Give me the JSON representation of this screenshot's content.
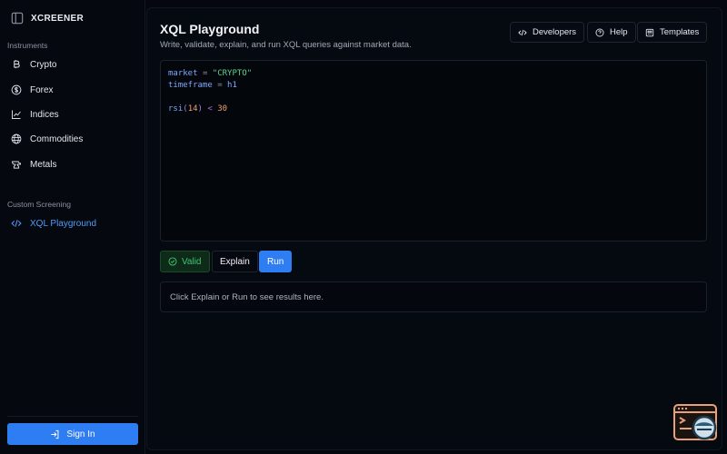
{
  "brand": {
    "name": "XCREENER"
  },
  "sidebar": {
    "section_instruments": "Instruments",
    "instruments": [
      {
        "label": "Crypto",
        "icon": "bitcoin-icon"
      },
      {
        "label": "Forex",
        "icon": "dollar-icon"
      },
      {
        "label": "Indices",
        "icon": "chart-line-icon"
      },
      {
        "label": "Commodities",
        "icon": "globe-icon"
      },
      {
        "label": "Metals",
        "icon": "anvil-icon"
      }
    ],
    "section_custom": "Custom Screening",
    "custom": [
      {
        "label": "XQL Playground",
        "icon": "code-icon",
        "active": true
      }
    ],
    "signin_label": "Sign In"
  },
  "header": {
    "title": "XQL Playground",
    "subtitle": "Write, validate, explain, and run XQL queries against market data.",
    "buttons": {
      "developers": "Developers",
      "help": "Help",
      "templates": "Templates"
    }
  },
  "editor": {
    "line1": {
      "ident": "market",
      "op": "=",
      "value": "\"CRYPTO\""
    },
    "line2": {
      "ident": "timeframe",
      "op": "=",
      "value": "h1"
    },
    "line4": {
      "func": "rsi",
      "open": "(",
      "arg": "14",
      "close": ")",
      "cmp": "<",
      "value": "30"
    }
  },
  "actions": {
    "valid_label": "Valid",
    "explain_label": "Explain",
    "run_label": "Run"
  },
  "results": {
    "placeholder": "Click Explain or Run to see results here."
  },
  "colors": {
    "accent": "#2f7df3",
    "valid": "#3fc672",
    "background": "#04070d"
  }
}
